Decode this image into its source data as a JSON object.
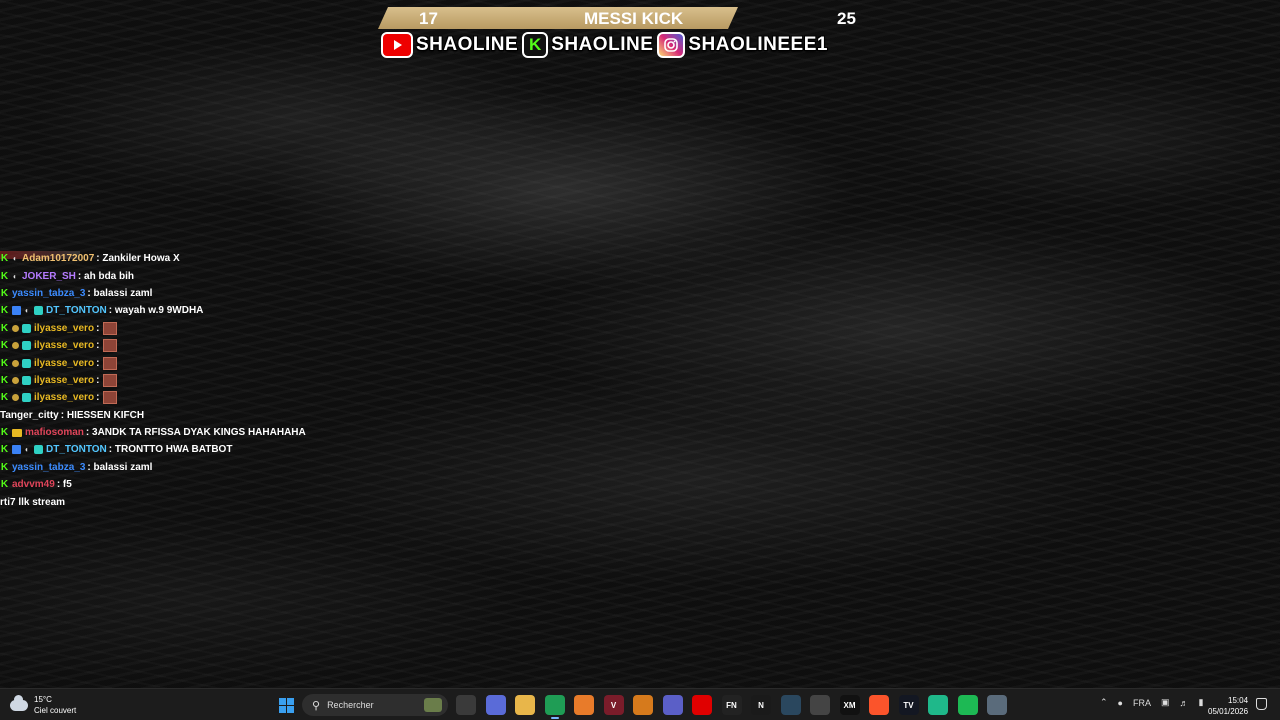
{
  "overlay": {
    "score_left": "17",
    "title": "MESSI KICK",
    "score_right": "25",
    "socials": [
      {
        "platform_icon": "youtube-icon",
        "handle": "SHAOLINE"
      },
      {
        "platform_icon": "kick-icon",
        "icon_glyph": "K",
        "handle": "SHAOLINE"
      },
      {
        "platform_icon": "instagram-icon",
        "handle": "SHAOLINEEE1"
      }
    ]
  },
  "chat": {
    "messages": [
      {
        "user": "Adam10172007",
        "color": "#f0c070",
        "badges": [
          "kick",
          "mute"
        ],
        "text": ": Zankiler Howa X"
      },
      {
        "user": "JOKER_SH",
        "color": "#b57bff",
        "badges": [
          "kick",
          "mute"
        ],
        "text": ": ah bda bih"
      },
      {
        "user": "yassin_tabza_3",
        "color": "#3c8cff",
        "badges": [
          "kick"
        ],
        "text": ": balassi zaml"
      },
      {
        "user": "DT_TONTON",
        "color": "#53c7ff",
        "badges": [
          "kick",
          "sub",
          "mute",
          "gift"
        ],
        "text": ": wayah w.9 9WDHA"
      },
      {
        "user": "ilyasse_vero",
        "color": "#e8b923",
        "badges": [
          "kick",
          "dot",
          "gift"
        ],
        "text": ":",
        "emote": true
      },
      {
        "user": "ilyasse_vero",
        "color": "#e8b923",
        "badges": [
          "kick",
          "dot",
          "gift"
        ],
        "text": ":",
        "emote": true
      },
      {
        "user": "ilyasse_vero",
        "color": "#e8b923",
        "badges": [
          "kick",
          "dot",
          "gift"
        ],
        "text": ":",
        "emote": true
      },
      {
        "user": "ilyasse_vero",
        "color": "#e8b923",
        "badges": [
          "kick",
          "dot",
          "gift"
        ],
        "text": ":",
        "emote": true
      },
      {
        "user": "ilyasse_vero",
        "color": "#e8b923",
        "badges": [
          "kick",
          "dot",
          "gift"
        ],
        "text": ":",
        "emote": true
      },
      {
        "user": "Tanger_citty",
        "color": "#ffffff",
        "badges": [],
        "text": ": HIESSEN KIFCH"
      },
      {
        "user": "mafiosoman",
        "color": "#e0455a",
        "badges": [
          "kick",
          "crown"
        ],
        "text": ": 3ANDK TA RFISSA DYAK KINGS HAHAHAHA"
      },
      {
        "user": "DT_TONTON",
        "color": "#53c7ff",
        "badges": [
          "kick",
          "sub",
          "mute",
          "gift"
        ],
        "text": ": TRONTTO HWA BATBOT"
      },
      {
        "user": "yassin_tabza_3",
        "color": "#3c8cff",
        "badges": [
          "kick"
        ],
        "text": ": balassi zaml"
      },
      {
        "user": "advvm49",
        "color": "#e0455a",
        "badges": [
          "kick"
        ],
        "text": ": f5"
      },
      {
        "user": "",
        "color": "#ffffff",
        "badges": [],
        "text": "rti7 llk stream"
      }
    ]
  },
  "taskbar": {
    "weather_temp": "15°C",
    "weather_desc": "Ciel couvert",
    "search_placeholder": "Rechercher",
    "apps": [
      {
        "name": "task-view-icon",
        "label": "",
        "bg": "#3a3a3a"
      },
      {
        "name": "copilot-icon",
        "label": "",
        "bg": "#5a6bd8"
      },
      {
        "name": "file-explorer-icon",
        "label": "",
        "bg": "#e8b64a"
      },
      {
        "name": "chrome-icon",
        "label": "",
        "bg": "#1f9d55",
        "active": true
      },
      {
        "name": "app-triangle-icon",
        "label": "",
        "bg": "#e87b2a"
      },
      {
        "name": "app-v-icon",
        "label": "V",
        "bg": "#7a1c2a"
      },
      {
        "name": "brave-like-icon",
        "label": "",
        "bg": "#d67a1c"
      },
      {
        "name": "teams-icon",
        "label": "",
        "bg": "#5b5fc7"
      },
      {
        "name": "youtube-icon",
        "label": "",
        "bg": "#e00000"
      },
      {
        "name": "fn-icon",
        "label": "FN",
        "bg": "#222222"
      },
      {
        "name": "netflix-icon",
        "label": "N",
        "bg": "#1a1a1a"
      },
      {
        "name": "steam-icon",
        "label": "",
        "bg": "#2a475e"
      },
      {
        "name": "settings-gear-icon",
        "label": "",
        "bg": "#444444"
      },
      {
        "name": "xm-icon",
        "label": "XM",
        "bg": "#111111"
      },
      {
        "name": "brave-icon",
        "label": "",
        "bg": "#fb542b"
      },
      {
        "name": "tradingview-icon",
        "label": "TV",
        "bg": "#131722"
      },
      {
        "name": "app-green-icon",
        "label": "",
        "bg": "#1fb88a"
      },
      {
        "name": "spotify-icon",
        "label": "",
        "bg": "#1db954"
      },
      {
        "name": "settings-icon",
        "label": "",
        "bg": "#5a6b7b"
      }
    ],
    "language": "FRA",
    "time": "15:04",
    "date": "05/01/2026"
  }
}
